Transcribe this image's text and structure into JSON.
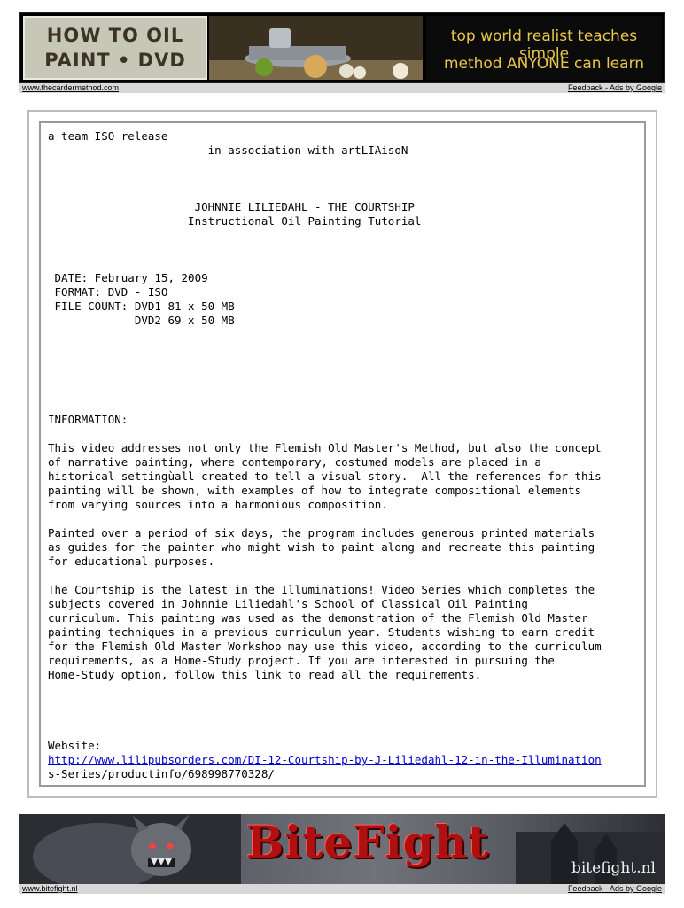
{
  "top_ad": {
    "logo_line1": "HOW TO OIL",
    "logo_line2": "PAINT • DVD",
    "tagline_line1": "top world realist teaches simple",
    "tagline_line2": "method ANYONE can learn",
    "link": "www.thecardermethod.com",
    "feedback": "Feedback - Ads by Google",
    "colors": {
      "tagline": "#e8c64a",
      "logo_bg": "#c7c7b8"
    }
  },
  "nfo": {
    "release_line": "a team ISO release",
    "association_line": "                        in association with artLIAisoN",
    "title_line1": "                      JOHNNIE LILIEDAHL - THE COURTSHIP",
    "title_line2": "                     Instructional Oil Painting Tutorial",
    "info_block": " DATE: February 15, 2009\n FORMAT: DVD - ISO\n FILE COUNT: DVD1 81 x 50 MB\n             DVD2 69 x 50 MB",
    "information_heading": "INFORMATION:",
    "paragraph1": "This video addresses not only the Flemish Old Master's Method, but also the concept\nof narrative painting, where contemporary, costumed models are placed in a\nhistorical settingùall created to tell a visual story.  All the references for this\npainting will be shown, with examples of how to integrate compositional elements\nfrom varying sources into a harmonious composition.",
    "paragraph2": "Painted over a period of six days, the program includes generous printed materials\nas guides for the painter who might wish to paint along and recreate this painting\nfor educational purposes.",
    "paragraph3": "The Courtship is the latest in the Illuminations! Video Series which completes the\nsubjects covered in Johnnie Liliedahl's School of Classical Oil Painting\ncurriculum. This painting was used as the demonstration of the Flemish Old Master\npainting techniques in a previous curriculum year. Students wishing to earn credit\nfor the Flemish Old Master Workshop may use this video, according to the curriculum\nrequirements, as a Home-Study project. If you are interested in pursuing the\nHome-Study option, follow this link to read all the requirements.",
    "website_label": "Website:",
    "website_link": "http://www.lilipubsorders.com/DI-12-Courtship-by-J-Liliedahl-12-in-the-Illumination",
    "website_continuation": "s-Series/productinfo/698998770328/"
  },
  "bottom_ad": {
    "title": "BiteFight",
    "domain": "bitefight.nl",
    "link": "www.bitefight.nl",
    "feedback": "Feedback - Ads by Google",
    "colors": {
      "title": "#b01010"
    }
  }
}
